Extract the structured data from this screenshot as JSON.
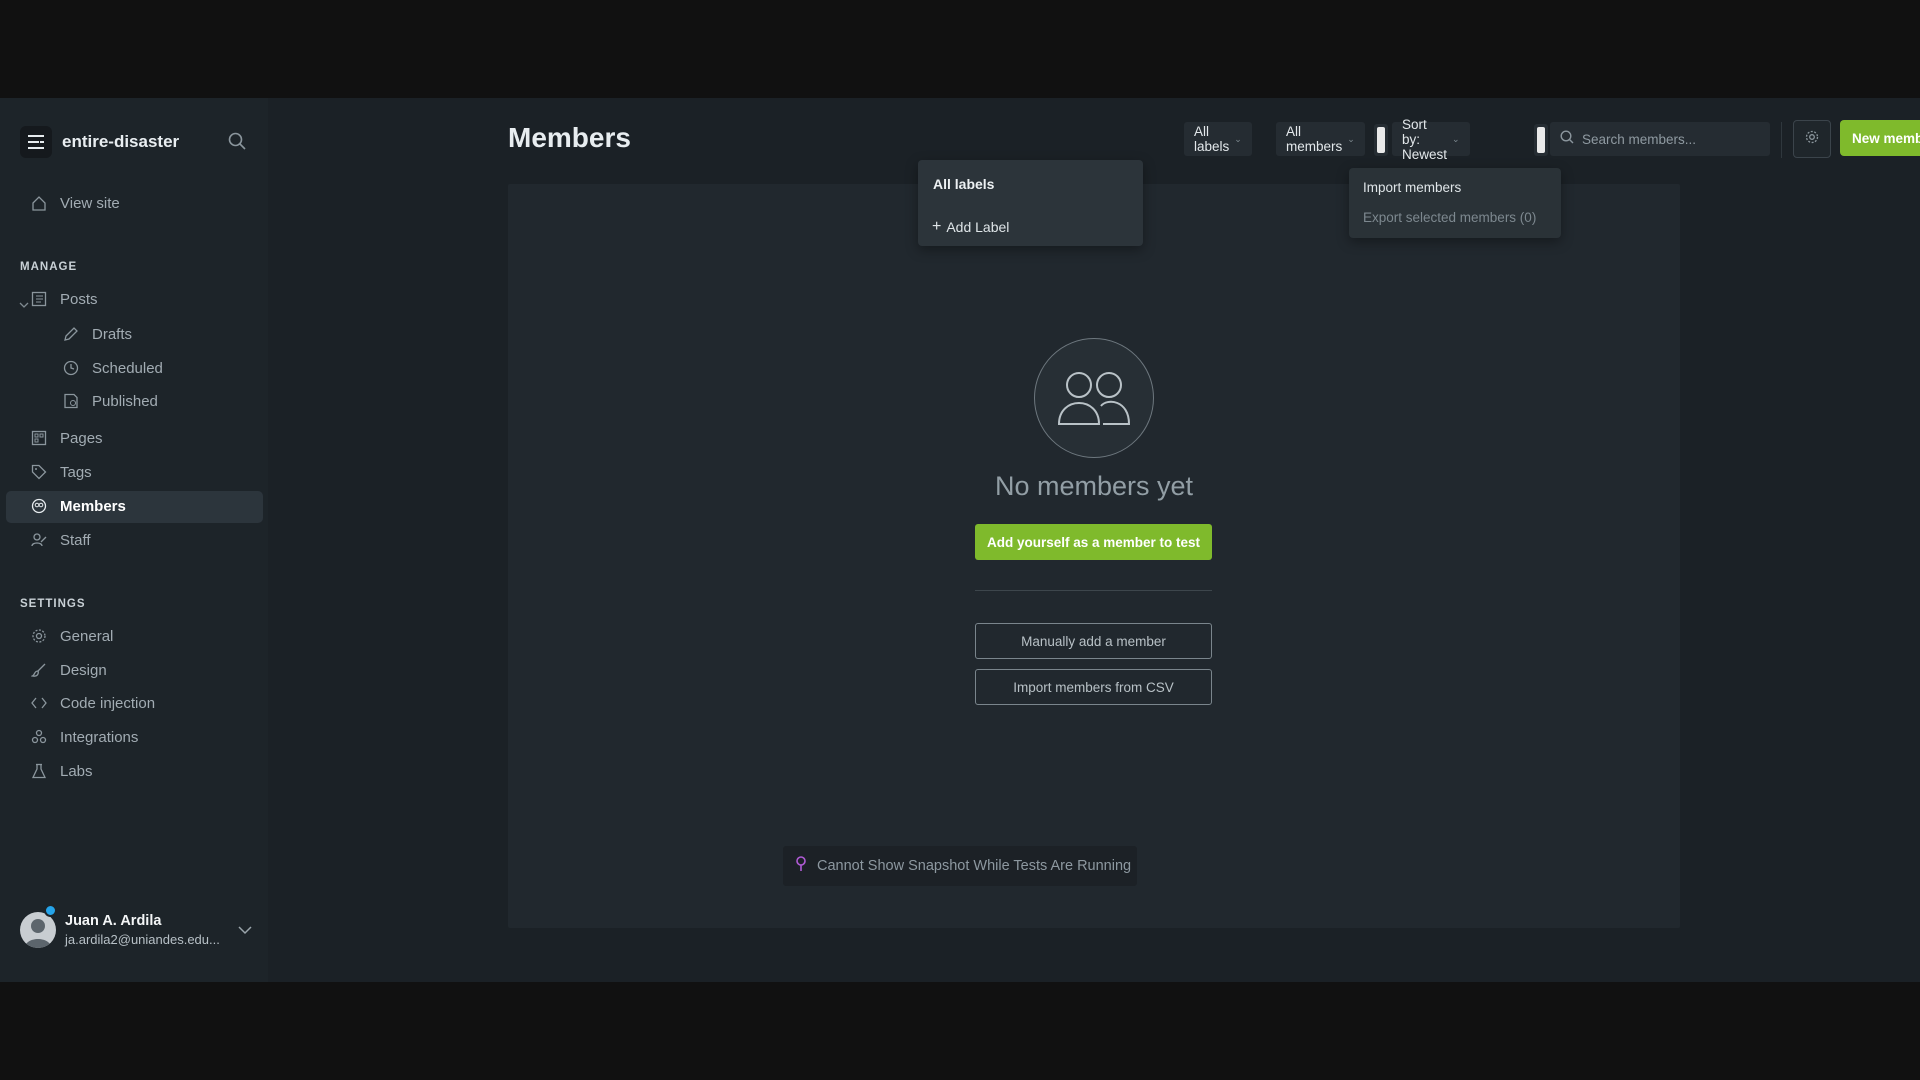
{
  "sidebar": {
    "site_name": "entire-disaster",
    "view_site": "View site",
    "manage_label": "MANAGE",
    "settings_label": "SETTINGS",
    "posts": "Posts",
    "drafts": "Drafts",
    "scheduled": "Scheduled",
    "published": "Published",
    "pages": "Pages",
    "tags": "Tags",
    "members": "Members",
    "staff": "Staff",
    "general": "General",
    "design": "Design",
    "code_injection": "Code injection",
    "integrations": "Integrations",
    "labs": "Labs",
    "user_name": "Juan A. Ardila",
    "user_email": "ja.ardila2@uniandes.edu..."
  },
  "header": {
    "title": "Members",
    "labels_filter": "All labels",
    "members_filter": "All members",
    "sort": "Sort by: Newest",
    "search_placeholder": "Search members...",
    "new_member": "New member"
  },
  "labels_dropdown": {
    "header": "All labels",
    "add_label": "Add Label"
  },
  "actions_dropdown": {
    "import": "Import members",
    "export": "Export selected members (0)"
  },
  "empty_state": {
    "title": "No members yet",
    "add_yourself": "Add yourself as a member to test",
    "manual_add": "Manually add a member",
    "import_csv": "Import members from CSV"
  },
  "snapshot_notice": "Cannot Show Snapshot While Tests Are Running",
  "colors": {
    "accent_green": "#7fba2c",
    "sidebar_bg": "#1d2429",
    "main_bg": "#1b2126",
    "avatar_status": "#25a4ea",
    "snapshot_pin": "#b15bd6"
  }
}
